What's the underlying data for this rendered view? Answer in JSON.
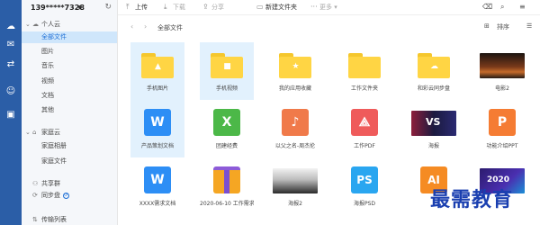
{
  "rail": {
    "icons": [
      "cloud-icon",
      "mail-icon",
      "transfer-icon",
      "contacts-icon",
      "note-icon"
    ]
  },
  "sidebar": {
    "account": "139*****7328",
    "sections": [
      {
        "label": "个人云",
        "items": [
          "全部文件",
          "图片",
          "音乐",
          "视频",
          "文档",
          "其他"
        ]
      },
      {
        "label": "家庭云",
        "items": [
          "家庭相册",
          "家庭文件"
        ]
      }
    ],
    "share_group": "共享群",
    "sync_disk": "同步盘",
    "transfer_list": "传输列表"
  },
  "toolbar": {
    "upload": "上传",
    "download": "下载",
    "share": "分享",
    "new_folder": "新建文件夹",
    "more": "更多"
  },
  "crumb": {
    "path": "全部文件",
    "sort": "排序"
  },
  "files": [
    {
      "name": "手机图片",
      "kind": "folder",
      "glyph": "▲",
      "selected": true
    },
    {
      "name": "手机视频",
      "kind": "folder",
      "glyph": "■",
      "selected": true
    },
    {
      "name": "我的应用收藏",
      "kind": "folder",
      "glyph": "★",
      "selected": false
    },
    {
      "name": "工作文件夹",
      "kind": "folder",
      "glyph": "",
      "selected": false
    },
    {
      "name": "和彩云同步盘",
      "kind": "folder",
      "glyph": "☁",
      "selected": false
    },
    {
      "name": "电影2",
      "kind": "image",
      "selected": false
    },
    {
      "name": "产品策划文档",
      "kind": "doc",
      "letter": "W",
      "color": "#2d8ef5",
      "selected": true
    },
    {
      "name": "团建经费",
      "kind": "doc",
      "letter": "X",
      "color": "#4cb848",
      "selected": false
    },
    {
      "name": "以父之名-周杰伦",
      "kind": "doc",
      "letter": "♪",
      "color": "#f07a4a",
      "selected": false
    },
    {
      "name": "工作PDF",
      "kind": "doc",
      "letter": "⟁",
      "color": "#ef5b5b",
      "selected": false
    },
    {
      "name": "海报",
      "kind": "image",
      "badge": "VS",
      "selected": false
    },
    {
      "name": "功能介绍PPT",
      "kind": "doc",
      "letter": "P",
      "color": "#f57c33",
      "selected": false
    },
    {
      "name": "XXXX需求文档",
      "kind": "doc",
      "letter": "W",
      "color": "#2d8ef5",
      "selected": false
    },
    {
      "name": "2020-06-10 工作需求",
      "kind": "zip",
      "selected": false
    },
    {
      "name": "海报2",
      "kind": "image",
      "selected": false
    },
    {
      "name": "海报PSD",
      "kind": "doc",
      "letter": "PS",
      "color": "#2aa6f0",
      "selected": false
    },
    {
      "name": "",
      "kind": "doc",
      "letter": "AI",
      "color": "#f58b23",
      "selected": false
    },
    {
      "name": "",
      "kind": "image",
      "badge": "2020",
      "selected": false
    }
  ],
  "watermark": "最需教育"
}
